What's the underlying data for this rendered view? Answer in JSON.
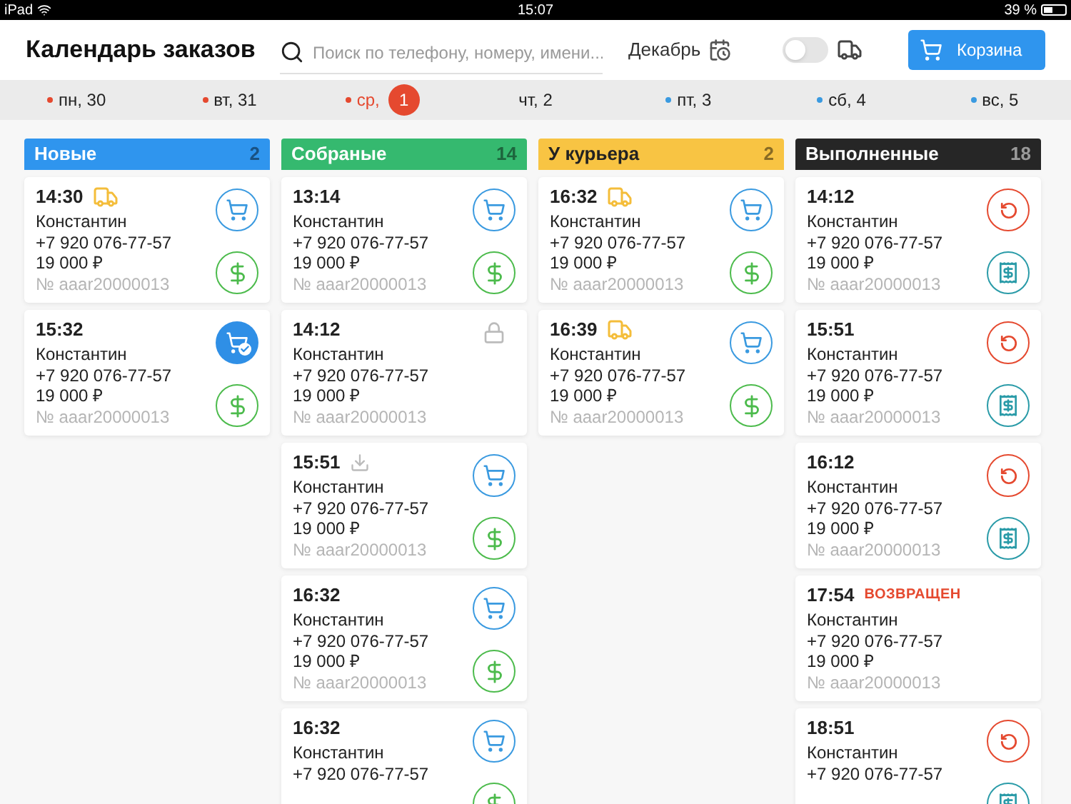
{
  "status_bar": {
    "device": "iPad",
    "time": "15:07",
    "battery": "39 %"
  },
  "header": {
    "title": "Календарь заказов",
    "search": {
      "placeholder": "Поиск по телефону, номеру, имени..."
    },
    "month": "Декабрь",
    "delivery_toggle": {
      "on": false
    },
    "cart_button": "Корзина"
  },
  "days": [
    {
      "label": "пн, 30",
      "color": "#e5492f",
      "selected": false
    },
    {
      "label": "вт, 31",
      "color": "#e5492f",
      "selected": false
    },
    {
      "label": "ср,",
      "color": "#e5492f",
      "selected": true,
      "badge": "1"
    },
    {
      "label": "чт, 2",
      "selected": false
    },
    {
      "label": "пт, 3",
      "color": "#3a9ae0",
      "selected": false
    },
    {
      "label": "сб, 4",
      "color": "#3a9ae0",
      "selected": false
    },
    {
      "label": "вс, 5",
      "color": "#3a9ae0",
      "selected": false
    }
  ],
  "columns": [
    {
      "title": "Новые",
      "count": "2",
      "color": "#2f95ee",
      "cards": [
        {
          "time": "14:30",
          "tag": {
            "kind": "truck"
          },
          "name": "Константин",
          "phone": "+7 920 076-77-57",
          "price": "19 000 ₽",
          "number": "№ aaar20000013",
          "actions": [
            {
              "kind": "cart"
            },
            {
              "kind": "payment"
            }
          ]
        },
        {
          "time": "15:32",
          "name": "Константин",
          "phone": "+7 920 076-77-57",
          "price": "19 000 ₽",
          "number": "№ aaar20000013",
          "actions": [
            {
              "kind": "cart_done"
            },
            {
              "kind": "payment"
            }
          ]
        }
      ]
    },
    {
      "title": "Собраные",
      "count": "14",
      "color": "#35b96f",
      "cards": [
        {
          "time": "13:14",
          "name": "Константин",
          "phone": "+7 920 076-77-57",
          "price": "19 000 ₽",
          "number": "№ aaar20000013",
          "actions": [
            {
              "kind": "cart"
            },
            {
              "kind": "payment"
            }
          ]
        },
        {
          "time": "14:12",
          "name": "Константин",
          "phone": "+7 920 076-77-57",
          "price": "19 000 ₽",
          "number": "№ aaar20000013",
          "actions": [
            {
              "kind": "lock"
            }
          ]
        },
        {
          "time": "15:51",
          "tag": {
            "kind": "download"
          },
          "name": "Константин",
          "phone": "+7 920 076-77-57",
          "price": "19 000 ₽",
          "number": "№ aaar20000013",
          "actions": [
            {
              "kind": "cart"
            },
            {
              "kind": "payment"
            }
          ]
        },
        {
          "time": "16:32",
          "name": "Константин",
          "phone": "+7 920 076-77-57",
          "price": "19 000 ₽",
          "number": "№ aaar20000013",
          "actions": [
            {
              "kind": "cart"
            },
            {
              "kind": "payment"
            }
          ]
        },
        {
          "time": "16:32",
          "name": "Константин",
          "phone": "+7 920 076-77-57",
          "actions": [
            {
              "kind": "cart"
            },
            {
              "kind": "payment"
            }
          ]
        }
      ]
    },
    {
      "title": "У курьера",
      "count": "2",
      "color": "#f8c443",
      "cards": [
        {
          "time": "16:32",
          "tag": {
            "kind": "truck"
          },
          "name": "Константин",
          "phone": "+7 920 076-77-57",
          "price": "19 000 ₽",
          "number": "№ aaar20000013",
          "actions": [
            {
              "kind": "cart"
            },
            {
              "kind": "payment"
            }
          ]
        },
        {
          "time": "16:39",
          "tag": {
            "kind": "truck"
          },
          "name": "Константин",
          "phone": "+7 920 076-77-57",
          "price": "19 000 ₽",
          "number": "№ aaar20000013",
          "actions": [
            {
              "kind": "cart"
            },
            {
              "kind": "payment"
            }
          ]
        }
      ]
    },
    {
      "title": "Выполненные",
      "count": "18",
      "color": "#262626",
      "cards": [
        {
          "time": "14:12",
          "name": "Константин",
          "phone": "+7 920 076-77-57",
          "price": "19 000 ₽",
          "number": "№ aaar20000013",
          "actions": [
            {
              "kind": "return"
            },
            {
              "kind": "receipt"
            }
          ]
        },
        {
          "time": "15:51",
          "name": "Константин",
          "phone": "+7 920 076-77-57",
          "price": "19 000 ₽",
          "number": "№ aaar20000013",
          "actions": [
            {
              "kind": "return"
            },
            {
              "kind": "receipt"
            }
          ]
        },
        {
          "time": "16:12",
          "name": "Константин",
          "phone": "+7 920 076-77-57",
          "price": "19 000 ₽",
          "number": "№ aaar20000013",
          "actions": [
            {
              "kind": "return"
            },
            {
              "kind": "receipt"
            }
          ]
        },
        {
          "time": "17:54",
          "status": "ВОЗВРАЩЕН",
          "name": "Константин",
          "phone": "+7 920 076-77-57",
          "price": "19 000 ₽",
          "number": "№ aaar20000013"
        },
        {
          "time": "18:51",
          "name": "Константин",
          "phone": "+7 920 076-77-57",
          "actions": [
            {
              "kind": "return"
            },
            {
              "kind": "receipt"
            }
          ]
        }
      ]
    }
  ]
}
